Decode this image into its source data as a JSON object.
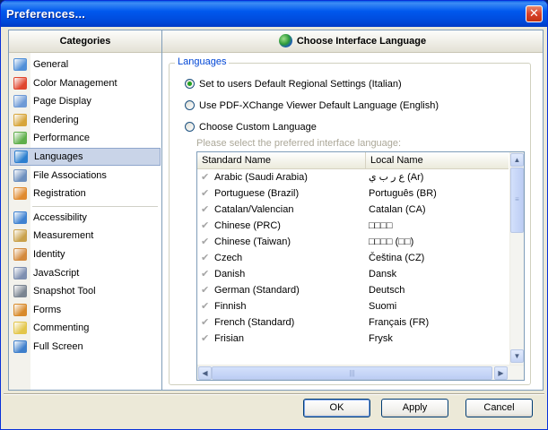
{
  "window": {
    "title": "Preferences...",
    "close_glyph": "✕"
  },
  "categories": {
    "header": "Categories",
    "items": [
      {
        "label": "General",
        "icon": "general-icon",
        "color": "#4f8fd8",
        "selected": false
      },
      {
        "label": "Color Management",
        "icon": "color-management-icon",
        "color": "#e0462e",
        "selected": false
      },
      {
        "label": "Page Display",
        "icon": "page-display-icon",
        "color": "#6e9ad6",
        "selected": false
      },
      {
        "label": "Rendering",
        "icon": "rendering-icon",
        "color": "#d7a53a",
        "selected": false
      },
      {
        "label": "Performance",
        "icon": "performance-icon",
        "color": "#5fae4a",
        "selected": false
      },
      {
        "label": "Languages",
        "icon": "languages-icon",
        "color": "#2c7fcf",
        "selected": true
      },
      {
        "label": "File Associations",
        "icon": "file-associations-icon",
        "color": "#6c8fbe",
        "selected": false
      },
      {
        "label": "Registration",
        "icon": "registration-icon",
        "color": "#e08a2e",
        "selected": false
      },
      {
        "label": "Accessibility",
        "icon": "accessibility-icon",
        "color": "#3f82d1",
        "selected": false
      },
      {
        "label": "Measurement",
        "icon": "measurement-icon",
        "color": "#c9a14a",
        "selected": false
      },
      {
        "label": "Identity",
        "icon": "identity-icon",
        "color": "#d48a3c",
        "selected": false
      },
      {
        "label": "JavaScript",
        "icon": "javascript-icon",
        "color": "#7e8fb0",
        "selected": false
      },
      {
        "label": "Snapshot Tool",
        "icon": "snapshot-tool-icon",
        "color": "#7b8591",
        "selected": false
      },
      {
        "label": "Forms",
        "icon": "forms-icon",
        "color": "#d88a2a",
        "selected": false
      },
      {
        "label": "Commenting",
        "icon": "commenting-icon",
        "color": "#e3c64a",
        "selected": false
      },
      {
        "label": "Full Screen",
        "icon": "full-screen-icon",
        "color": "#3e7fcb",
        "selected": false
      }
    ]
  },
  "content": {
    "header": "Choose Interface Language",
    "header_icon": "globe-icon",
    "group_label": "Languages",
    "options": [
      {
        "label": "Set to users Default Regional Settings (Italian)",
        "checked": true
      },
      {
        "label": "Use PDF-XChange Viewer Default Language (English)",
        "checked": false
      },
      {
        "label": "Choose Custom Language",
        "checked": false
      }
    ],
    "hint": "Please select the preferred interface language:",
    "columns": {
      "standard": "Standard Name",
      "local": "Local Name"
    },
    "languages": [
      {
        "standard": "Arabic (Saudi Arabia)",
        "local": "ع ر ب ي (Ar)"
      },
      {
        "standard": "Portuguese (Brazil)",
        "local": "Português (BR)"
      },
      {
        "standard": "Catalan/Valencian",
        "local": "Catalan (CA)"
      },
      {
        "standard": "Chinese (PRC)",
        "local": "□□□□"
      },
      {
        "standard": "Chinese (Taiwan)",
        "local": "□□□□ (□□)"
      },
      {
        "standard": "Czech",
        "local": "Čeština (CZ)"
      },
      {
        "standard": "Danish",
        "local": "Dansk"
      },
      {
        "standard": "German (Standard)",
        "local": "Deutsch"
      },
      {
        "standard": "Finnish",
        "local": "Suomi"
      },
      {
        "standard": "French (Standard)",
        "local": "Français (FR)"
      },
      {
        "standard": "Frisian",
        "local": "Frysk"
      }
    ],
    "check_glyph": "✔",
    "scroll": {
      "up": "▲",
      "down": "▼",
      "left": "◀",
      "right": "▶",
      "grip_v": "≡",
      "grip_h": "|||"
    }
  },
  "buttons": {
    "ok": "OK",
    "apply": "Apply",
    "cancel": "Cancel"
  }
}
